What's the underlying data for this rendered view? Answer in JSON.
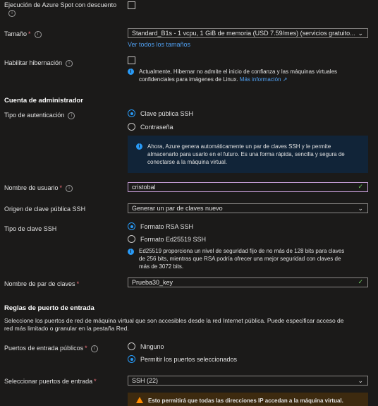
{
  "spot": {
    "label": "Ejecución de Azure Spot con descuento"
  },
  "size": {
    "label": "Tamaño",
    "value": "Standard_B1s - 1 vcpu, 1 GiB de memoria (USD 7.59/mes) (servicios gratuito...",
    "link": "Ver todos los tamaños"
  },
  "hibernation": {
    "label": "Habilitar hibernación",
    "note": "Actualmente, Hibernar no admite el inicio de confianza y las máquinas virtuales",
    "note2": "confidenciales para imágenes de Linux.",
    "more": "Más información"
  },
  "admin": {
    "title": "Cuenta de administrador",
    "auth_label": "Tipo de autenticación",
    "auth_opt1": "Clave pública SSH",
    "auth_opt2": "Contraseña",
    "banner_line1": "Ahora, Azure genera automáticamente un par de claves SSH y le permite",
    "banner_line2": "almacenarlo para usarlo en el futuro. Es una forma rápida, sencilla y segura de",
    "banner_line3": "conectarse a la máquina virtual.",
    "username_label": "Nombre de usuario",
    "username_value": "cristobal",
    "source_label": "Origen de clave pública SSH",
    "source_value": "Generar un par de claves nuevo",
    "keytype_label": "Tipo de clave SSH",
    "keytype_opt1": "Formato RSA SSH",
    "keytype_opt2": "Formato Ed25519 SSH",
    "keytype_note1": "Ed25519 proporciona un nivel de seguridad fijo de no más de 128 bits para claves",
    "keytype_note2": "de 256 bits, mientras que RSA podría ofrecer una mejor seguridad con claves de",
    "keytype_note3": "más de 3072 bits.",
    "keypair_label": "Nombre de par de claves",
    "keypair_value": "Prueba30_key"
  },
  "ports": {
    "title": "Reglas de puerto de entrada",
    "desc1": "Seleccione los puertos de red de máquina virtual que son accesibles desde la red Internet pública. Puede especificar acceso de",
    "desc2": "red más limitado o granular en la pestaña Red.",
    "public_label": "Puertos de entrada públicos",
    "public_opt1": "Ninguno",
    "public_opt2": "Permitir los puertos seleccionados",
    "select_label": "Seleccionar puertos de entrada",
    "select_value": "SSH (22)",
    "warning": "Esto permitirá que todas las direcciones IP accedan a la máquina virtual."
  }
}
